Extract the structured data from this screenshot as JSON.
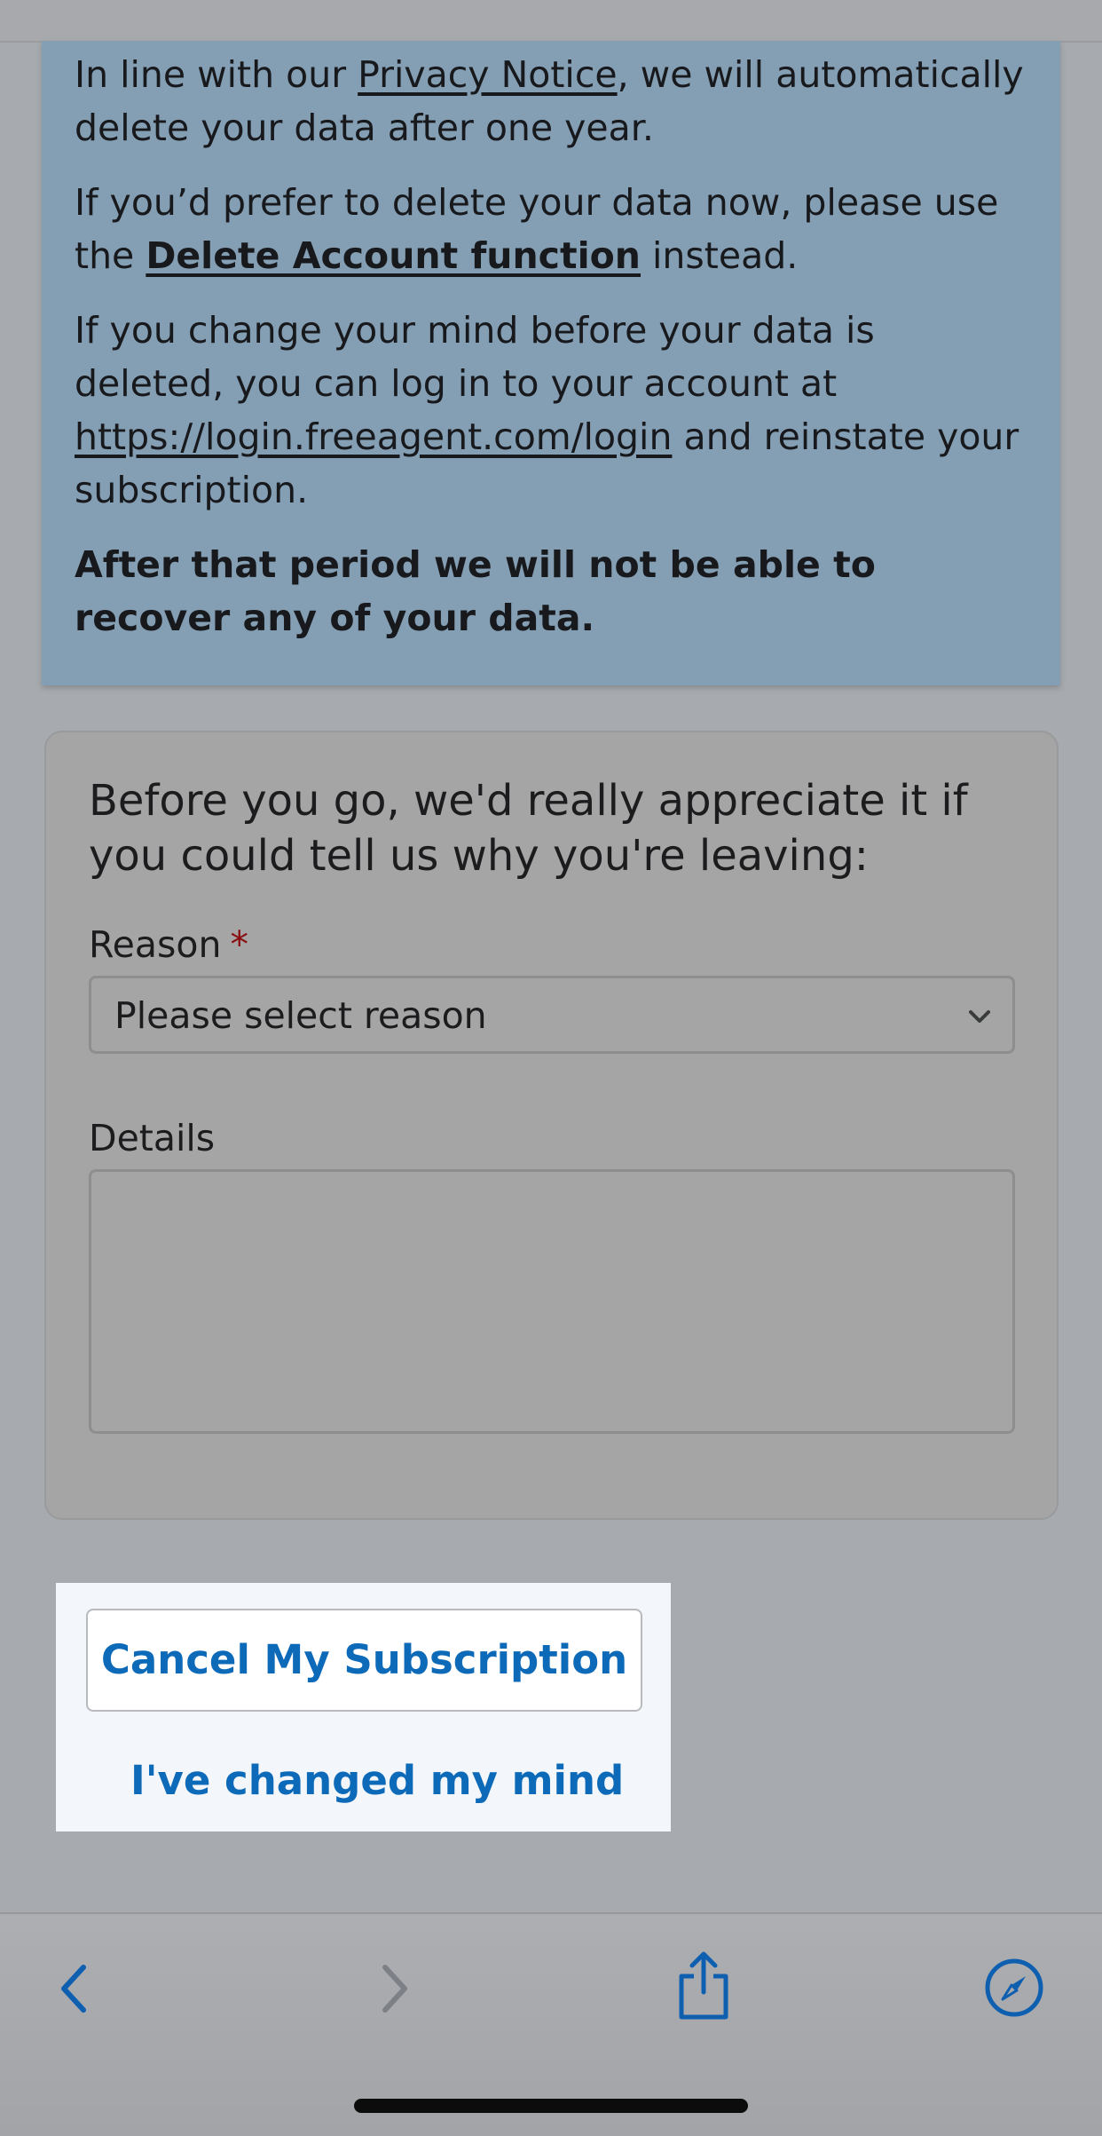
{
  "info": {
    "p1_prefix": "In line with our ",
    "privacy_link": "Privacy Notice",
    "p1_suffix": ", we will automatically delete your data after one year.",
    "p2_prefix": "If you’d prefer to delete your data now, please use the ",
    "delete_link": "Delete Account function",
    "p2_suffix": " instead.",
    "p3_prefix": "If you change your mind before your data is deleted, you can log in to your account at ",
    "login_link": "https://login.freeagent.com/login",
    "p3_suffix": " and reinstate your subscription.",
    "warning": "After that period we will not be able to recover any of your data."
  },
  "form": {
    "intro": "Before you go, we'd really appreciate it if you could tell us why you're leaving:",
    "reason_label": "Reason",
    "required_marker": "*",
    "reason_value": "Please select reason",
    "details_label": "Details",
    "details_value": ""
  },
  "actions": {
    "cancel_label": "Cancel My Subscription",
    "changed_mind_label": "I've changed my mind"
  },
  "toolbar": {
    "icons": [
      "back-chevron-icon",
      "forward-chevron-icon",
      "share-icon",
      "compass-icon"
    ]
  },
  "colors": {
    "info_background": "#849eb4",
    "link_blue": "#0d6ab8",
    "required_red": "#8a0c10"
  }
}
